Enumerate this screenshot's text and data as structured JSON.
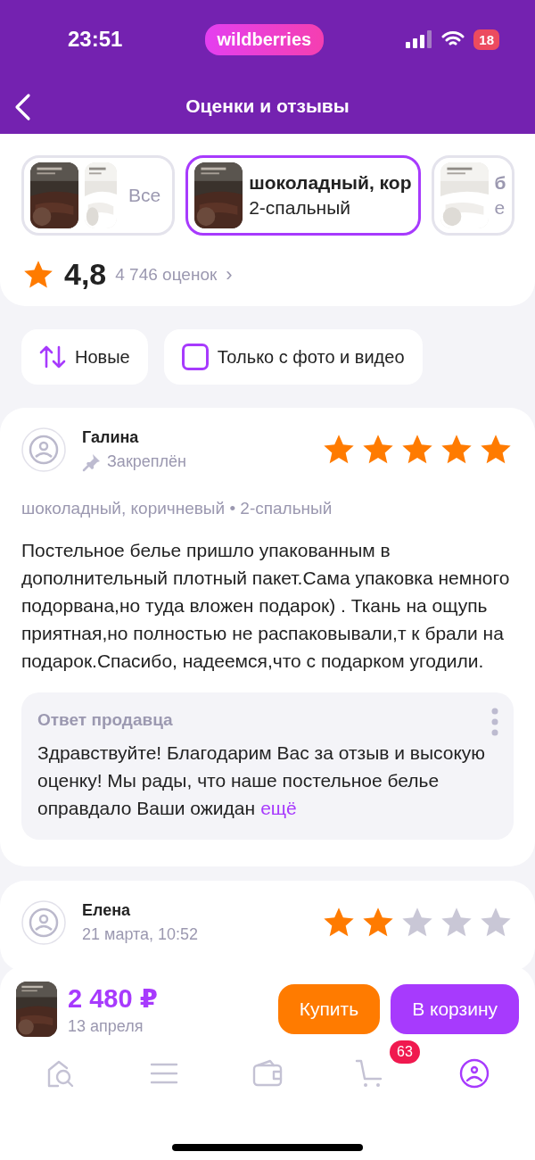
{
  "status_bar": {
    "time": "23:51",
    "logo": "wildberries",
    "battery": "18"
  },
  "header": {
    "title": "Оценки и отзывы"
  },
  "variants": [
    {
      "kind": "pair",
      "label": "Все",
      "selected": false
    },
    {
      "kind": "single",
      "title": "шоколадный, кор",
      "subtitle": "2-спальный",
      "selected": true
    },
    {
      "kind": "single",
      "title": "б",
      "subtitle": "е",
      "selected": false
    }
  ],
  "rating": {
    "value": "4,8",
    "count": "4 746 оценок",
    "chevron": "›"
  },
  "filters": [
    {
      "kind": "sort",
      "label": "Новые"
    },
    {
      "kind": "checkbox",
      "label": "Только с фото и видео",
      "checked": false
    }
  ],
  "reviews": [
    {
      "author": "Галина",
      "meta": "Закреплён",
      "pinned": true,
      "stars": 5,
      "variant": "шоколадный, коричневый • 2-спальный",
      "text": "Постельное белье пришло упакованным в дополнительный плотный пакет.Сама упаковка немного подорвана,но туда вложен подарок) . Ткань на ощупь приятная,но полностью не распаковывали,т к брали на подарок.Спасибо, надеемся,что с подарком угодили.",
      "reply": {
        "title": "Ответ продавца",
        "text": "Здравствуйте! Благодарим Вас за отзыв и высокую оценку! Мы рады, что наше постельное белье оправдало Ваши ожидан",
        "more": "ещё"
      }
    },
    {
      "author": "Елена",
      "meta": "21 марта, 10:52",
      "pinned": false,
      "stars": 2
    }
  ],
  "product_bar": {
    "price": "2 480 ₽",
    "date": "13 апреля",
    "buttons": [
      {
        "kind": "buy",
        "label": "Купить"
      },
      {
        "kind": "cart",
        "label": "В корзину"
      }
    ]
  },
  "nav": [
    {
      "kind": "home",
      "selected": false
    },
    {
      "kind": "menu",
      "selected": false
    },
    {
      "kind": "wallet",
      "selected": false
    },
    {
      "kind": "cart",
      "selected": false,
      "badge": "63"
    },
    {
      "kind": "profile",
      "selected": true
    }
  ]
}
